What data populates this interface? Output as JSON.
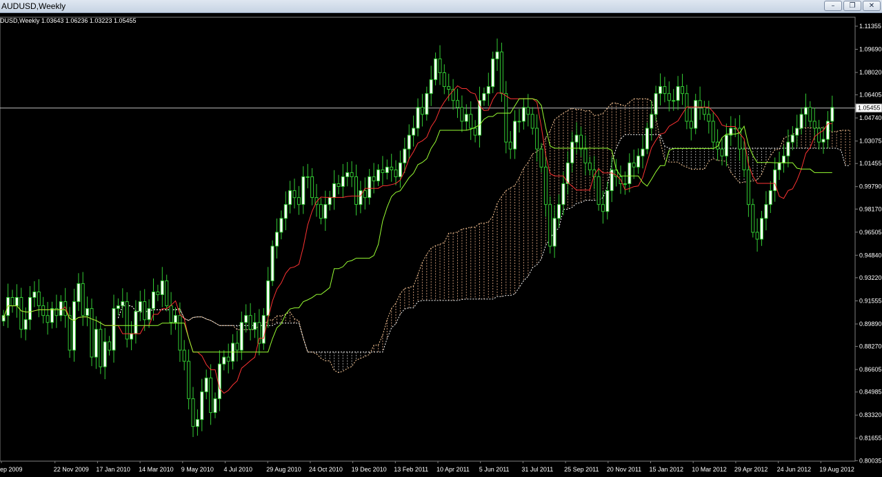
{
  "window": {
    "title": "AUDUSD,Weekly",
    "minimize_icon": "minimize-icon",
    "maximize_icon": "restore-icon",
    "close_icon": "close-icon"
  },
  "info_line": "DUSD,Weekly  1.03643 1.06236 1.03223 1.05455",
  "colors": {
    "background": "#000000",
    "bull_candle": "#ffffff",
    "bear_candle": "#000000",
    "wick": "#33cc33",
    "tenkan": "#ff3333",
    "kijun": "#99ff33",
    "senkou_a": "#ffcc99",
    "senkou_b": "#ffffff",
    "cloud_bull": "#c09070",
    "cloud_bear": "#a0a0a0",
    "price_line": "#c0c0c0",
    "axis_text": "#ffffff"
  },
  "chart_data": {
    "type": "candlestick",
    "symbol": "AUDUSD",
    "timeframe": "Weekly",
    "overlay": "Ichimoku Kinko Hyo",
    "current_price": 1.05455,
    "current_price_label": "1.05455",
    "ylim": [
      0.8,
      1.12
    ],
    "y_ticks": [
      "1.11355",
      "1.09690",
      "1.08020",
      "1.06405",
      "1.04740",
      "1.03075",
      "1.01455",
      "0.99790",
      "0.98170",
      "0.96505",
      "0.94840",
      "0.93220",
      "0.91555",
      "0.89890",
      "0.88270",
      "0.86605",
      "0.84985",
      "0.83320",
      "0.81655",
      "0.80035"
    ],
    "x_ticks": [
      "ep 2009",
      "22 Nov 2009",
      "17 Jan 2010",
      "14 Mar 2010",
      "9 May 2010",
      "4 Jul 2010",
      "29 Aug 2010",
      "24 Oct 2010",
      "19 Dec 2010",
      "13 Feb 2011",
      "10 Apr 2011",
      "5 Jun 2011",
      "31 Jul 2011",
      "25 Sep 2011",
      "20 Nov 2011",
      "15 Jan 2012",
      "10 Mar 2012",
      "29 Apr 2012",
      "24 Jun 2012",
      "19 Aug 2012"
    ],
    "closes": [
      0.905,
      0.918,
      0.912,
      0.918,
      0.895,
      0.902,
      0.918,
      0.922,
      0.912,
      0.905,
      0.9,
      0.91,
      0.905,
      0.915,
      0.905,
      0.88,
      0.915,
      0.928,
      0.905,
      0.91,
      0.875,
      0.895,
      0.868,
      0.886,
      0.88,
      0.91,
      0.912,
      0.915,
      0.888,
      0.892,
      0.908,
      0.915,
      0.902,
      0.91,
      0.922,
      0.92,
      0.93,
      0.912,
      0.9,
      0.905,
      0.88,
      0.872,
      0.845,
      0.825,
      0.83,
      0.85,
      0.86,
      0.835,
      0.845,
      0.87,
      0.875,
      0.872,
      0.885,
      0.88,
      0.9,
      0.905,
      0.895,
      0.9,
      0.885,
      0.905,
      0.93,
      0.955,
      0.965,
      0.975,
      0.985,
      0.995,
      0.99,
      0.985,
      1.005,
      1.005,
      0.99,
      0.985,
      0.975,
      0.985,
      0.99,
      1.0,
      0.998,
      1.005,
      1.008,
      1.005,
      0.985,
      0.995,
      0.99,
      1.005,
      1.002,
      1.01,
      1.008,
      1.012,
      1.01,
      1.005,
      1.015,
      1.025,
      1.035,
      1.04,
      1.055,
      1.05,
      1.065,
      1.075,
      1.09,
      1.08,
      1.07,
      1.068,
      1.06,
      1.055,
      1.045,
      1.05,
      1.04,
      1.035,
      1.06,
      1.065,
      1.07,
      1.09,
      1.095,
      1.065,
      1.03,
      1.025,
      1.045,
      1.045,
      1.055,
      1.05,
      1.04,
      1.025,
      1.012,
      0.985,
      0.955,
      0.975,
      0.985,
      1.0,
      1.015,
      1.03,
      1.035,
      1.025,
      1.015,
      1.01,
      1.005,
      0.985,
      0.98,
      0.995,
      1.01,
      1.005,
      1.0,
      1.0,
      1.015,
      1.012,
      1.02,
      1.025,
      1.04,
      1.05,
      1.065,
      1.07,
      1.065,
      1.06,
      1.06,
      1.07,
      1.065,
      1.045,
      1.04,
      1.06,
      1.055,
      1.05,
      1.045,
      1.03,
      1.025,
      1.02,
      1.035,
      1.04,
      1.04,
      1.025,
      1.01,
      0.985,
      0.965,
      0.96,
      0.975,
      0.985,
      0.995,
      1.01,
      1.015,
      1.02,
      1.03,
      1.035,
      1.04,
      1.05,
      1.055,
      1.045,
      1.04,
      1.03,
      1.032,
      1.045,
      1.055
    ]
  }
}
